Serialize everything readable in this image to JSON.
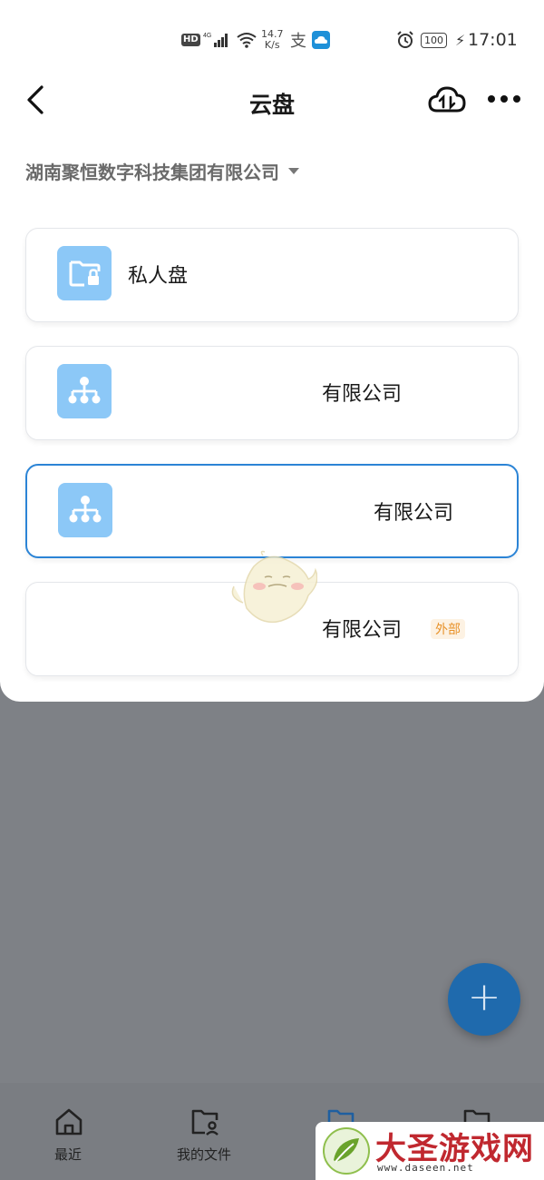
{
  "status_bar": {
    "hd": "HD",
    "network": "4G",
    "speed_value": "14.7",
    "speed_unit": "K/s",
    "alipay_glyph": "支",
    "battery": "100",
    "time": "17:01"
  },
  "header": {
    "title": "云盘",
    "back_icon": "chevron-left-icon",
    "upload_icon": "cloud-transfer-icon",
    "more_icon": "more-horizontal-icon"
  },
  "company_selector": {
    "name": "湖南聚恒数字科技集团有限公司"
  },
  "drives": [
    {
      "label": "私人盘",
      "icon": "folder-lock-icon",
      "selected": false
    },
    {
      "label": "有限公司",
      "icon": "org-tree-icon",
      "selected": false
    },
    {
      "label": "有限公司",
      "icon": "org-tree-icon",
      "selected": true
    },
    {
      "label": "有限公司",
      "tag": "外部",
      "icon": "none",
      "selected": false
    }
  ],
  "fab": {
    "label": "+"
  },
  "bottom_nav": {
    "items": [
      {
        "label": "最近",
        "icon": "home-icon"
      },
      {
        "label": "我的文件",
        "icon": "folder-user-icon"
      },
      {
        "label": "",
        "icon": "folder-icon",
        "active": true
      },
      {
        "label": "",
        "icon": "folder-icon"
      }
    ]
  },
  "watermark": {
    "title": "大圣游戏网",
    "url": "www.daseen.net"
  },
  "colors": {
    "accent": "#2b84d6",
    "icon_bg": "#8cc8f7",
    "fab": "#1f6aad",
    "tag_text": "#e8922a",
    "overlay": "#7e8186"
  }
}
